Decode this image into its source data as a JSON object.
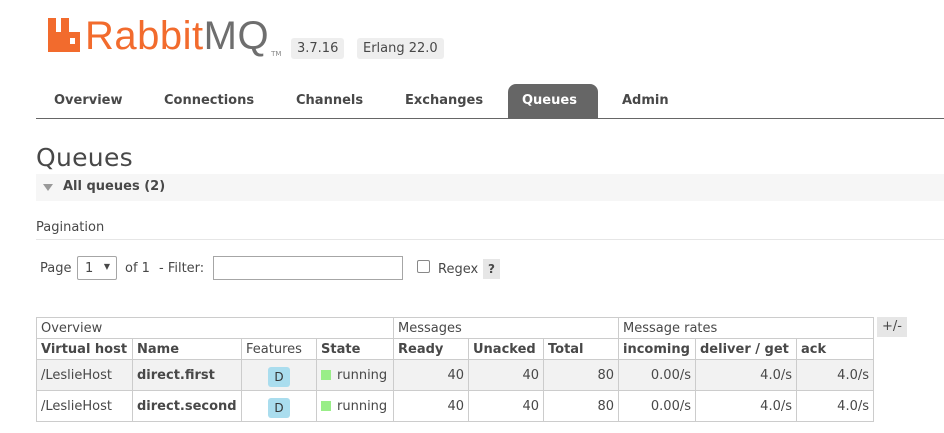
{
  "header": {
    "logo_rabbit": "Rabbit",
    "logo_mq": "MQ",
    "logo_tm": "TM",
    "version": "3.7.16",
    "erlang": "Erlang 22.0"
  },
  "tabs": [
    {
      "label": "Overview",
      "active": false
    },
    {
      "label": "Connections",
      "active": false
    },
    {
      "label": "Channels",
      "active": false
    },
    {
      "label": "Exchanges",
      "active": false
    },
    {
      "label": "Queues",
      "active": true
    },
    {
      "label": "Admin",
      "active": false
    }
  ],
  "page": {
    "title": "Queues",
    "section_label": "All queues (2)"
  },
  "pagination": {
    "title": "Pagination",
    "page_label": "Page",
    "page_value": "1",
    "of_label": "of 1",
    "filter_label": "- Filter:",
    "filter_value": "",
    "regex_label": "Regex",
    "regex_checked": false,
    "help": "?"
  },
  "table": {
    "groups": [
      "Overview",
      "Messages",
      "Message rates"
    ],
    "columns": [
      "Virtual host",
      "Name",
      "Features",
      "State",
      "Ready",
      "Unacked",
      "Total",
      "incoming",
      "deliver / get",
      "ack"
    ],
    "toggle": "+/-",
    "rows": [
      {
        "vhost": "/LeslieHost",
        "name": "direct.first",
        "features": "D",
        "state": "running",
        "ready": "40",
        "unacked": "40",
        "total": "80",
        "incoming": "0.00/s",
        "deliver_get": "4.0/s",
        "ack": "4.0/s"
      },
      {
        "vhost": "/LeslieHost",
        "name": "direct.second",
        "features": "D",
        "state": "running",
        "ready": "40",
        "unacked": "40",
        "total": "80",
        "incoming": "0.00/s",
        "deliver_get": "4.0/s",
        "ack": "4.0/s"
      }
    ]
  },
  "colors": {
    "brand": "#f26b2d",
    "tab_active": "#666666",
    "feature_badge": "#aaddee",
    "state_running": "#99ee88"
  }
}
